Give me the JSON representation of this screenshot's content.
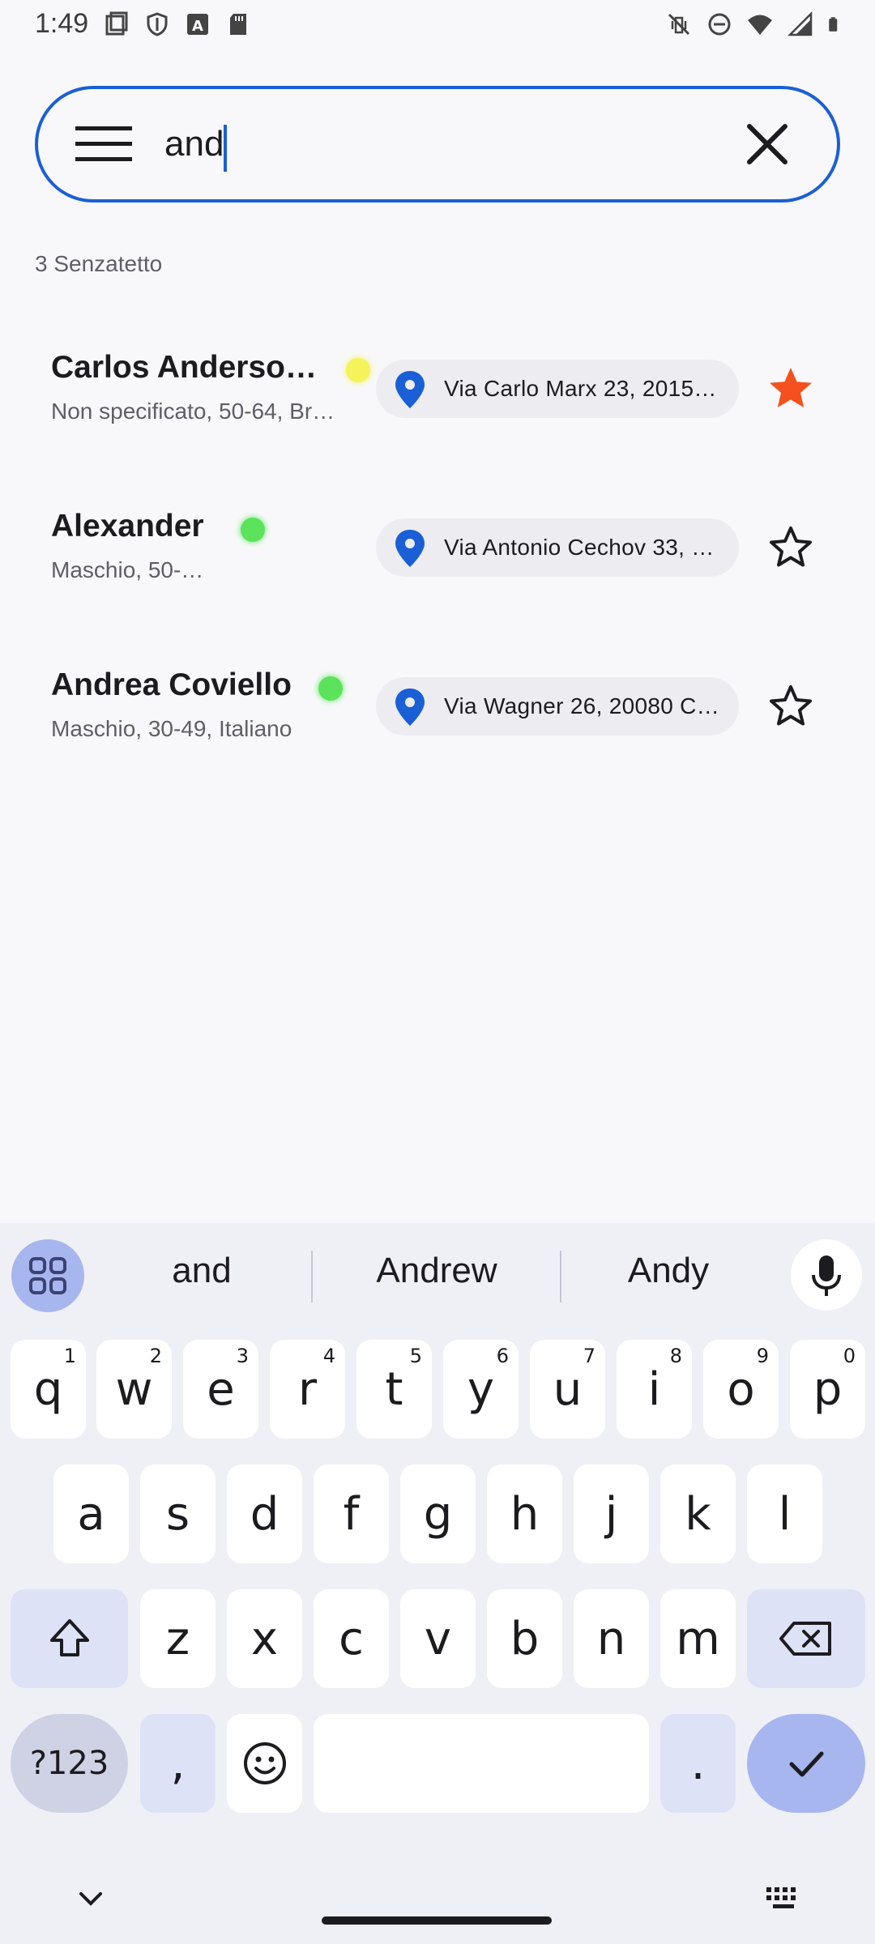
{
  "status_bar": {
    "time": "1:49",
    "left_icons": [
      "screenshot-icon",
      "shield-icon",
      "a-icon",
      "sd-card-icon"
    ],
    "right_icons": [
      "vibrate-off-icon",
      "do-not-disturb-icon",
      "wifi-icon",
      "signal-icon",
      "battery-icon"
    ]
  },
  "search": {
    "value": "and",
    "menu_icon": "menu-icon",
    "clear_icon": "close-icon",
    "accent": "#1a5fd6"
  },
  "results_label": "3 Senzatetto",
  "results": [
    {
      "name": "Carlos Anderso…",
      "subtitle": "Non specificato, 50-64,  Br…",
      "status_color": "#f5f35a",
      "address": "Via Carlo Marx 23, 2015…",
      "favorite": true
    },
    {
      "name": "Alexander",
      "subtitle": "Maschio, 50-…",
      "status_color": "#5be35b",
      "address": "Via Antonio Cechov 33, …",
      "favorite": false
    },
    {
      "name": "Andrea Coviello",
      "subtitle": "Maschio, 30-49,  Italiano",
      "status_color": "#5be35b",
      "address": "Via Wagner 26, 20080 C…",
      "favorite": false
    }
  ],
  "colors": {
    "pin": "#1a5fd6",
    "star_filled": "#f4511e"
  },
  "keyboard": {
    "suggestions": [
      "and",
      "Andrew",
      "Andy"
    ],
    "row1": [
      {
        "k": "q",
        "n": "1"
      },
      {
        "k": "w",
        "n": "2"
      },
      {
        "k": "e",
        "n": "3"
      },
      {
        "k": "r",
        "n": "4"
      },
      {
        "k": "t",
        "n": "5"
      },
      {
        "k": "y",
        "n": "6"
      },
      {
        "k": "u",
        "n": "7"
      },
      {
        "k": "i",
        "n": "8"
      },
      {
        "k": "o",
        "n": "9"
      },
      {
        "k": "p",
        "n": "0"
      }
    ],
    "row2": [
      "a",
      "s",
      "d",
      "f",
      "g",
      "h",
      "j",
      "k",
      "l"
    ],
    "row3": [
      "z",
      "x",
      "c",
      "v",
      "b",
      "n",
      "m"
    ],
    "symbols_label": "?123",
    "comma": ",",
    "period": "."
  }
}
